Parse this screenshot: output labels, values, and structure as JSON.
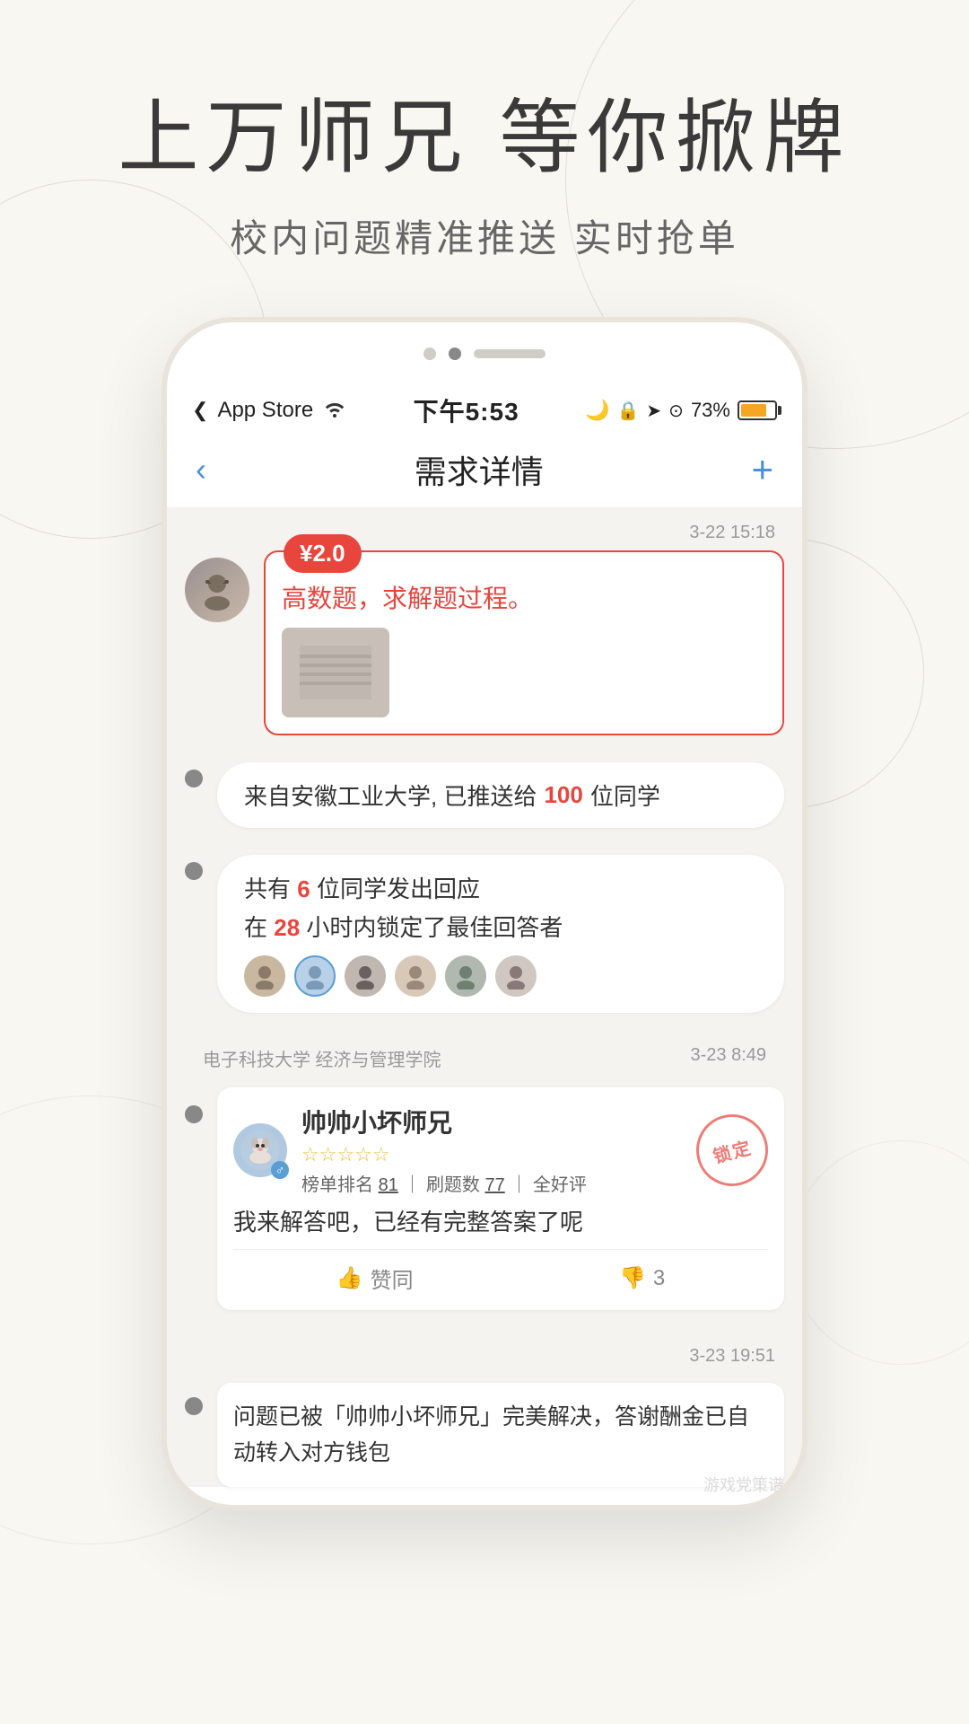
{
  "hero": {
    "title": "上万师兄 等你掀牌",
    "subtitle": "校内问题精准推送  实时抢单"
  },
  "phone": {
    "status_bar": {
      "app_store": "App Store",
      "wifi_icon": "wifi",
      "time": "下午5:53",
      "moon_icon": "moon",
      "lock_icon": "lock",
      "nav_icon": "nav",
      "camera_icon": "camera",
      "battery": "73%"
    },
    "nav": {
      "back_icon": "chevron-left",
      "title": "需求详情",
      "add_icon": "plus"
    },
    "question": {
      "timestamp": "3-22 15:18",
      "price": "¥2.0",
      "text": "高数题，求解题过程。",
      "has_image": true
    },
    "info_pill_1": {
      "text": "来自安徽工业大学, 已推送给",
      "highlight": "100",
      "text2": "位同学"
    },
    "info_pill_2": {
      "text1": "共有",
      "highlight1": "6",
      "text2": "位同学发出回应",
      "text3": "在",
      "highlight2": "28",
      "text4": "小时内锁定了最佳回答者"
    },
    "response": {
      "school": "电子科技大学  经济与管理学院",
      "timestamp": "3-23 8:49",
      "name": "帅帅小坏师兄",
      "stars": "☆☆☆☆☆",
      "rank_label": "榜单排名",
      "rank": "81",
      "quiz_label": "刷题数",
      "quiz": "77",
      "review_label": "全好评",
      "text": "我来解答吧，已经有完整答案了呢",
      "like_label": "赞同",
      "dislike_count": "3",
      "lock_label": "锁定"
    },
    "final_message": {
      "timestamp": "3-23 19:51",
      "text1": "问题已被「帅帅小坏师兄」完美解决，答谢酬金已自动转入对方钱包"
    }
  },
  "pagination": {
    "dots": [
      "inactive",
      "active",
      "bar"
    ]
  },
  "watermark": "游戏党策谱"
}
